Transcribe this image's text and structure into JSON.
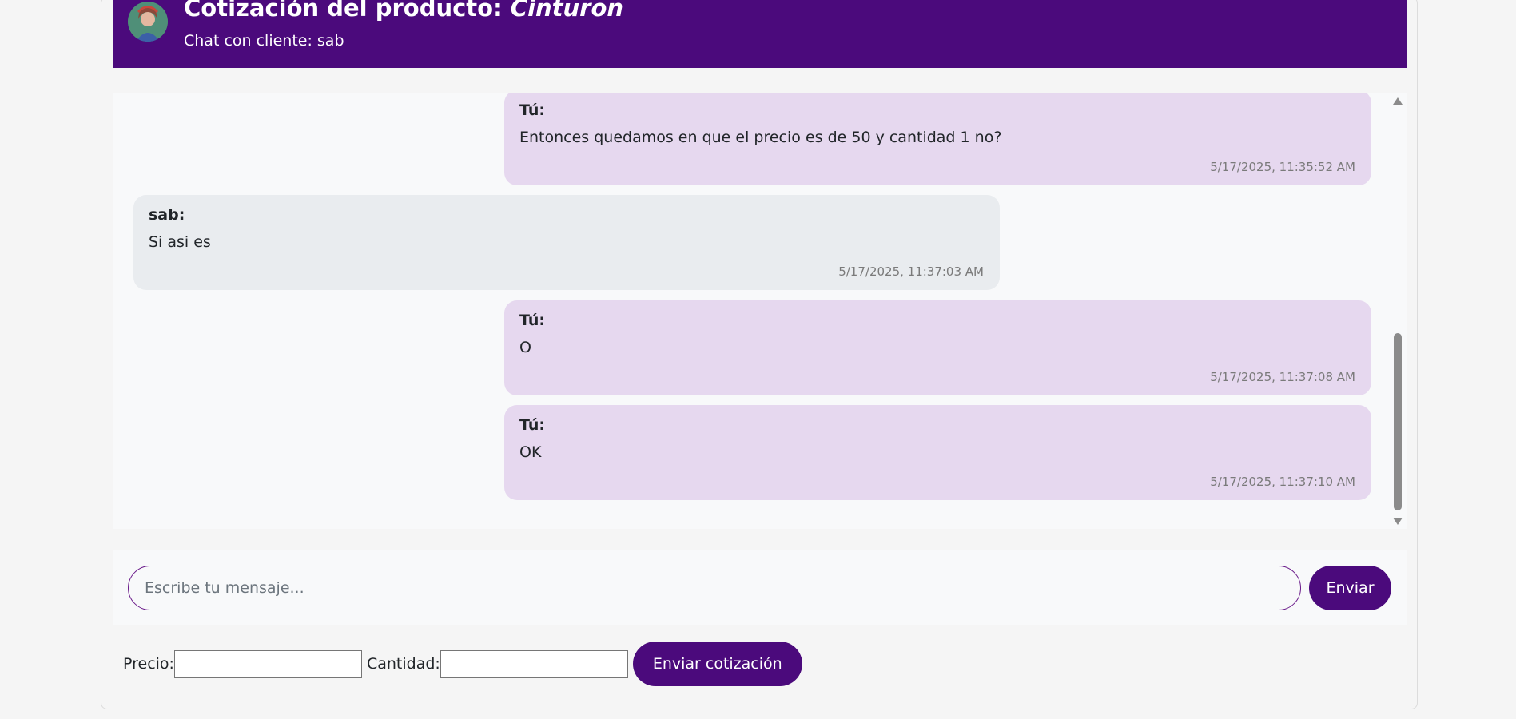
{
  "header": {
    "title_prefix": "Cotización del producto: ",
    "product_name": "Cinturon",
    "subtitle": "Chat con cliente: sab",
    "color": "#4b0a7c"
  },
  "messages": [
    {
      "sender": "Tú:",
      "text": "Entonces quedamos en que el precio es de 50 y cantidad 1 no?",
      "time": "5/17/2025, 11:35:52 AM",
      "from_me": true
    },
    {
      "sender": "sab:",
      "text": "Si asi es",
      "time": "5/17/2025, 11:37:03 AM",
      "from_me": false
    },
    {
      "sender": "Tú:",
      "text": "O",
      "time": "5/17/2025, 11:37:08 AM",
      "from_me": true
    },
    {
      "sender": "Tú:",
      "text": "OK",
      "time": "5/17/2025, 11:37:10 AM",
      "from_me": true
    }
  ],
  "composer": {
    "placeholder": "Escribe tu mensaje...",
    "send_label": "Enviar"
  },
  "quote": {
    "price_label": "Precio:",
    "quantity_label": "Cantidad:",
    "submit_label": "Enviar cotización"
  }
}
